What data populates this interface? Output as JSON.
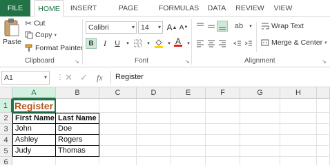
{
  "tabs": [
    "FILE",
    "HOME",
    "INSERT",
    "PAGE LAYOUT",
    "FORMULAS",
    "DATA",
    "REVIEW",
    "VIEW"
  ],
  "ribbon": {
    "clipboard": {
      "paste": "Paste",
      "cut": "Cut",
      "copy": "Copy",
      "format_painter": "Format Painter",
      "label": "Clipboard"
    },
    "font": {
      "name": "Calibri",
      "size": "14",
      "bold": "B",
      "italic": "I",
      "underline": "U",
      "grow": "A",
      "shrink": "A",
      "fill_letter": "A",
      "label": "Font"
    },
    "alignment": {
      "wrap_text": "Wrap Text",
      "merge_center": "Merge & Center",
      "label": "Alignment"
    }
  },
  "formula_bar": {
    "name_box": "A1",
    "fx": "fx",
    "value": "Register"
  },
  "grid": {
    "columns": [
      "A",
      "B",
      "C",
      "D",
      "E",
      "F",
      "G",
      "H"
    ],
    "rows": [
      "1",
      "2",
      "3",
      "4",
      "5",
      "6"
    ],
    "cells": {
      "a1": "Register",
      "a2": "First Name",
      "b2": "Last Name",
      "a3": "John",
      "b3": "Doe",
      "a4": "Ashley",
      "b4": "Rogers",
      "a5": "Judy",
      "b5": "Thomas"
    }
  },
  "colors": {
    "accent": "#217346",
    "title_text": "#b4551f"
  }
}
